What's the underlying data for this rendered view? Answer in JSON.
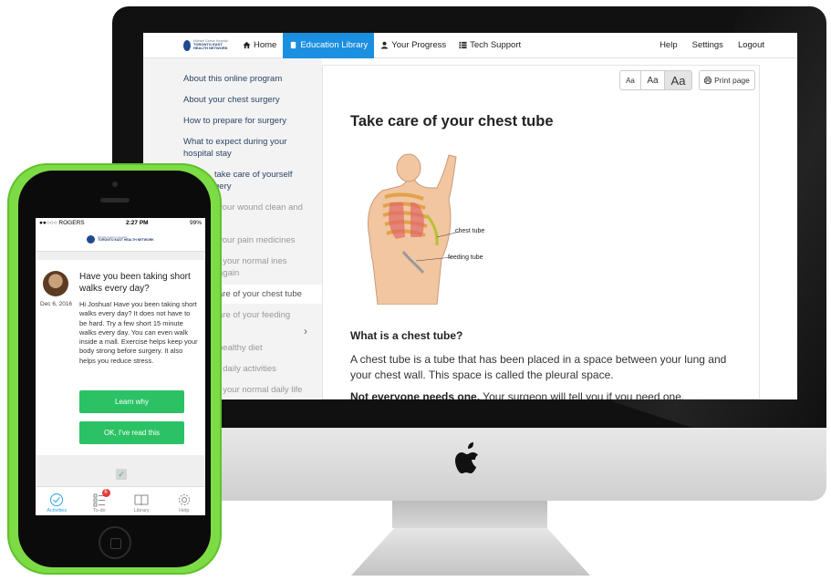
{
  "brand": {
    "line1": "Michael Garron Hospital",
    "line2": "TORONTO EAST HEALTH NETWORK"
  },
  "nav": {
    "home": "Home",
    "education": "Education Library",
    "progress": "Your Progress",
    "support": "Tech Support",
    "help": "Help",
    "settings": "Settings",
    "logout": "Logout"
  },
  "sidebar": {
    "items": [
      "About this online program",
      "About your chest surgery",
      "How to prepare for surgery",
      "What to expect during your hospital stay",
      "take care of yourself gery",
      "your wound clean and",
      "your pain medicines",
      "t your normal ines again",
      "are of your chest tube",
      "are of your feeding",
      "healthy diet",
      "t daily activities",
      "t your normal daily life"
    ]
  },
  "content": {
    "font_small": "Aa",
    "font_medium": "Aa",
    "font_large": "Aa",
    "print_label": "Print page",
    "title": "Take care of your chest tube",
    "label_chest_tube": "chest tube",
    "label_feeding_tube": "feeding tube",
    "subheading": "What is a chest tube?",
    "paragraph": "A chest tube is a tube that has been placed in a space between your lung and your chest wall. This space is called the pleural space.",
    "para2_bold": "Not everyone needs one.",
    "para2_rest": " Your surgeon will tell you if you need one."
  },
  "phone": {
    "carrier": "●●○○○ ROGERS",
    "time": "2:27 PM",
    "battery": "99%",
    "message": {
      "title": "Have you been taking short walks every day?",
      "date": "Dec 6, 2016",
      "body": "Hi Joshua! Have you been taking short walks every day? It does not have to be hard. Try a few short 15 minute walks every day. You can even walk inside a mall. Exercise helps keep your body strong before surgery. It also helps you reduce stress.",
      "learn_button": "Learn why",
      "read_button": "OK, I've read this"
    },
    "tabs": {
      "activities": "Activities",
      "todo": "To-do",
      "todo_badge": "6",
      "library": "Library",
      "help": "Help"
    }
  },
  "colors": {
    "nav_active": "#1b8fe0",
    "button_green": "#2bc265",
    "phone_case": "#7ddc46",
    "tab_active": "#2ba4e3"
  }
}
